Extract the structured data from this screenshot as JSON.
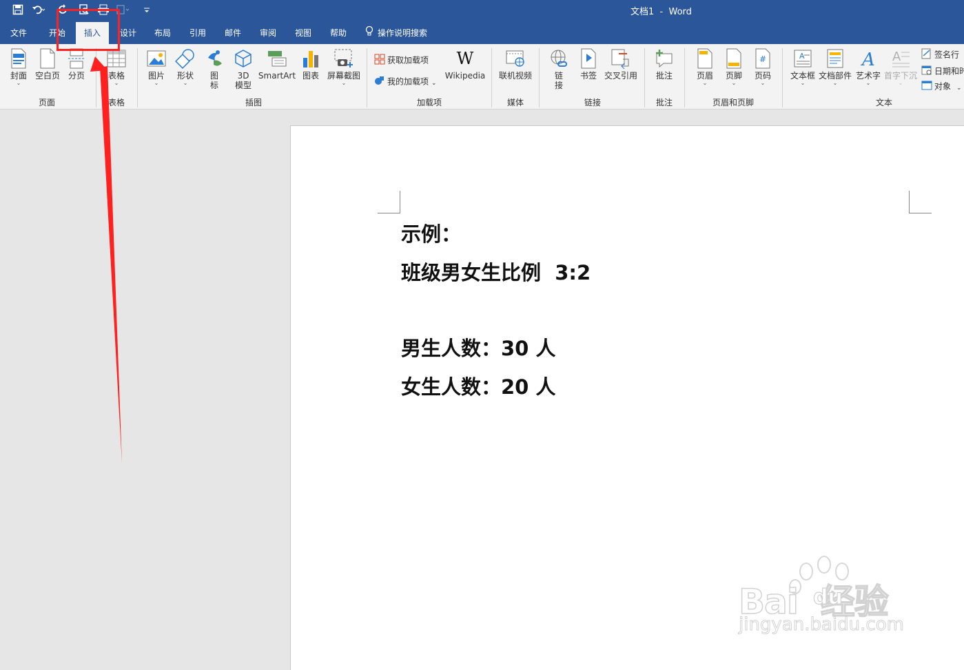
{
  "window": {
    "title": "文档1  -  Word"
  },
  "quick_access": {
    "icons": [
      "save-icon",
      "undo-icon",
      "redo-icon",
      "print-preview-icon",
      "print-icon",
      "touch-mode-icon",
      "customize-qat-icon"
    ]
  },
  "tabs": [
    {
      "label": "文件",
      "active": false
    },
    {
      "label": "开始",
      "active": false
    },
    {
      "label": "插入",
      "active": true
    },
    {
      "label": "设计",
      "active": false
    },
    {
      "label": "布局",
      "active": false
    },
    {
      "label": "引用",
      "active": false
    },
    {
      "label": "邮件",
      "active": false
    },
    {
      "label": "审阅",
      "active": false
    },
    {
      "label": "视图",
      "active": false
    },
    {
      "label": "帮助",
      "active": false
    }
  ],
  "tell_me": {
    "label": "操作说明搜索",
    "icon": "lightbulb-icon"
  },
  "ribbon": {
    "groups": {
      "pages": "页面",
      "tables": "表格",
      "illustrations": "插图",
      "addins": "加载项",
      "media": "媒体",
      "links": "链接",
      "comments": "批注",
      "header_footer": "页眉和页脚",
      "text": "文本"
    },
    "buttons": {
      "cover": "封面",
      "blank_page": "空白页",
      "page_break": "分页",
      "table": "表格",
      "pictures": "图片",
      "shapes": "形状",
      "icons_1": "图",
      "icons_2": "标",
      "model_3d_1": "3D",
      "model_3d_2": "模型",
      "smartart": "SmartArt",
      "chart": "图表",
      "screenshot": "屏幕截图",
      "get_addins": "获取加载项",
      "my_addins": "我的加载项",
      "wikipedia": "Wikipedia",
      "online_video": "联机视频",
      "link_1": "链",
      "link_2": "接",
      "bookmark": "书签",
      "cross_ref": "交叉引用",
      "comment": "批注",
      "header": "页眉",
      "footer": "页脚",
      "page_number": "页码",
      "text_box": "文本框",
      "quick_parts": "文档部件",
      "wordart": "艺术字",
      "drop_cap": "首字下沉",
      "signature_line": "签名行",
      "date_time": "日期和时",
      "object": "对象"
    }
  },
  "document": {
    "lines": [
      "示例：",
      "班级男女生比例  3:2",
      "男生人数：30 人",
      "女生人数：20 人"
    ]
  },
  "watermark": {
    "brand": "Bai  经验",
    "brand_mid": "du",
    "url": "jingyan.baidu.com"
  },
  "colors": {
    "title_bar": "#2b579a",
    "ribbon_bg": "#f3f3f3",
    "annotation": "#ff2020",
    "canvas": "#e6e6e6"
  }
}
